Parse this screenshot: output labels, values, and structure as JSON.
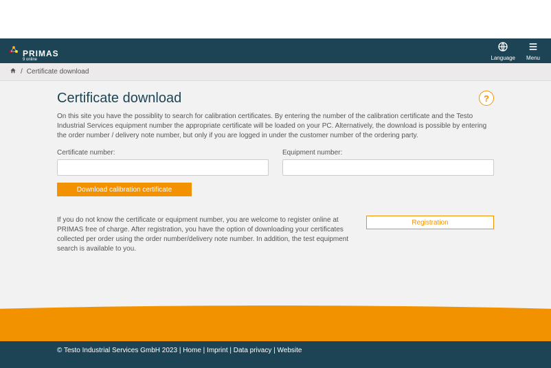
{
  "header": {
    "logo_main": "PRIMAS",
    "logo_sub": "9 online",
    "language_label": "Language",
    "menu_label": "Menu"
  },
  "breadcrumb": {
    "current": "Certificate download"
  },
  "page": {
    "title": "Certificate download",
    "help_symbol": "?",
    "intro": "On this site you have the possiblity to search for calibration certificates. By entering the number of the calibration certificate and the Testo Industrial Services equipment number the appropriate certificate will be loaded on your PC. Alternatively, the download is possible by entering the order number / delivery note number, but only if you are logged in under the customer number of the ordering party.",
    "cert_label": "Certificate number:",
    "equip_label": "Equipment number:",
    "download_button": "Download calibration certificate",
    "info_text": "If you do not know the certificate or equipment number, you are welcome to register online at PRIMAS free of charge. After registration, you have the option of downloading your certificates collected per order using the order number/delivery note number. In addition, the test equipment search is available to you.",
    "registration_button": "Registration"
  },
  "footer": {
    "copyright": "© Testo Industrial Services GmbH 2023",
    "sep": " | ",
    "links": {
      "home": "Home",
      "imprint": "Imprint",
      "privacy": "Data privacy",
      "website": "Website"
    }
  }
}
